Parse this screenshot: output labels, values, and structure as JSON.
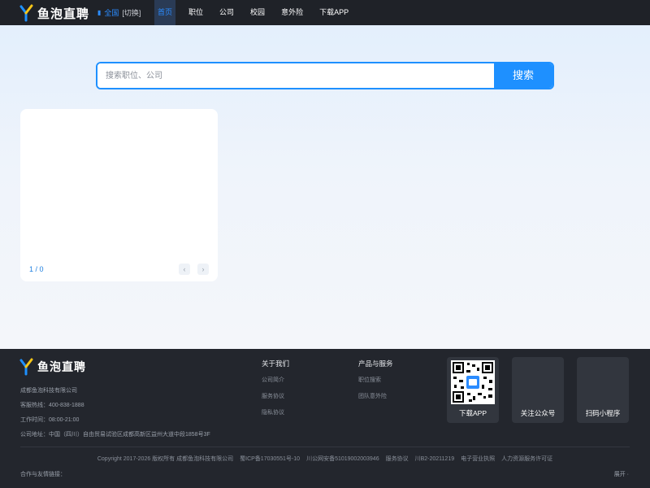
{
  "header": {
    "logo_text": "鱼泡直聘",
    "city": {
      "name": "全国",
      "switch_label": "[切换]",
      "pin_icon": "location-pin-icon"
    },
    "nav": [
      {
        "label": "首页",
        "active": true
      },
      {
        "label": "职位",
        "active": false
      },
      {
        "label": "公司",
        "active": false
      },
      {
        "label": "校园",
        "active": false
      },
      {
        "label": "意外险",
        "active": false
      },
      {
        "label": "下载APP",
        "active": false
      }
    ]
  },
  "search": {
    "placeholder": "搜索职位、公司",
    "value": "",
    "button_label": "搜索"
  },
  "carousel": {
    "pager_text": "1 / 0",
    "prev_glyph": "‹",
    "next_glyph": "›"
  },
  "footer": {
    "logo_text": "鱼泡直聘",
    "company": "成都鱼泡科技有限公司",
    "hotline": "客服热线：400-838-1888",
    "hours": "工作时间：08:00-21:00",
    "address": "公司地址：中国（四川）自由贸易试验区成都高新区益州大道中段1858号3F",
    "about": {
      "title": "关于我们",
      "links": [
        "公司简介",
        "服务协议",
        "隐私协议"
      ]
    },
    "products": {
      "title": "产品与服务",
      "links": [
        "职位搜索",
        "团队意外险"
      ]
    },
    "qr_boxes": [
      {
        "label": "下载APP",
        "has_qr": true
      },
      {
        "label": "关注公众号",
        "has_qr": false
      },
      {
        "label": "扫码小程序",
        "has_qr": false
      }
    ],
    "bottom_items": [
      "Copyright 2017-2026 版权所有 成都鱼泡科技有限公司",
      "蜀ICP备17030551号-10",
      "川公网安备51019002003946",
      "服务协议",
      "川B2-20211219",
      "电子营业执照",
      "人力资源服务许可证"
    ],
    "friend_links_label": "合作与友情链接：",
    "expand_label": "展开 ·"
  },
  "colors": {
    "accent": "#1e90ff",
    "topbar": "#1f2228",
    "footer": "#23262d"
  }
}
